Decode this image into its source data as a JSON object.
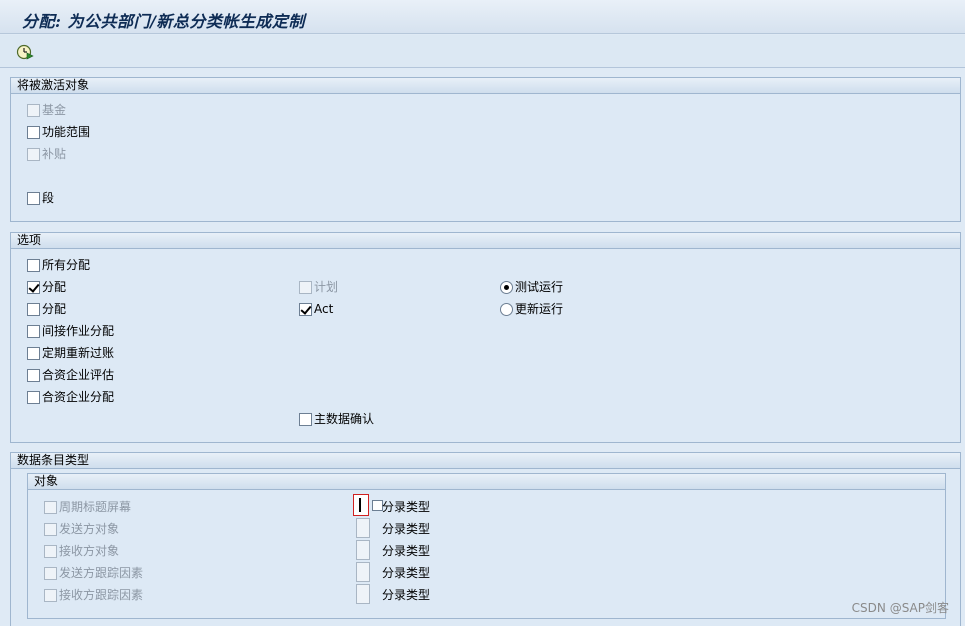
{
  "window": {
    "title": "分配: 为公共部门/新总分类帐生成定制"
  },
  "toolbar": {
    "execute_icon": "clock-execute-icon"
  },
  "section_activate": {
    "header": "将被激活对象",
    "items": [
      {
        "label": "基金",
        "checked": false,
        "disabled": true
      },
      {
        "label": "功能范围",
        "checked": false,
        "disabled": false
      },
      {
        "label": "补贴",
        "checked": false,
        "disabled": true
      },
      {
        "label": "段",
        "checked": false,
        "disabled": false
      }
    ]
  },
  "section_options": {
    "header": "选项",
    "left": [
      {
        "label": "所有分配",
        "checked": false
      },
      {
        "label": "分配",
        "checked": true
      },
      {
        "label": "分配",
        "checked": false
      },
      {
        "label": "间接作业分配",
        "checked": false
      },
      {
        "label": "定期重新过账",
        "checked": false
      },
      {
        "label": "合资企业评估",
        "checked": false
      },
      {
        "label": "合资企业分配",
        "checked": false
      }
    ],
    "middle": [
      {
        "label": "计划",
        "checked": false,
        "disabled": true
      },
      {
        "label": "Act",
        "checked": true,
        "disabled": false
      },
      {
        "label": "主数据确认",
        "checked": false,
        "disabled": false
      }
    ],
    "radios": [
      {
        "label": "测试运行",
        "selected": true
      },
      {
        "label": "更新运行",
        "selected": false
      }
    ]
  },
  "section_doc_types": {
    "header": "数据条目类型",
    "subgroup_header": "对象",
    "rows": [
      {
        "label": "周期标题屏幕",
        "field_label": "分录类型"
      },
      {
        "label": "发送方对象",
        "field_label": "分录类型"
      },
      {
        "label": "接收方对象",
        "field_label": "分录类型"
      },
      {
        "label": "发送方跟踪因素",
        "field_label": "分录类型"
      },
      {
        "label": "接收方跟踪因素",
        "field_label": "分录类型"
      }
    ]
  },
  "watermark": "CSDN @SAP剑客"
}
